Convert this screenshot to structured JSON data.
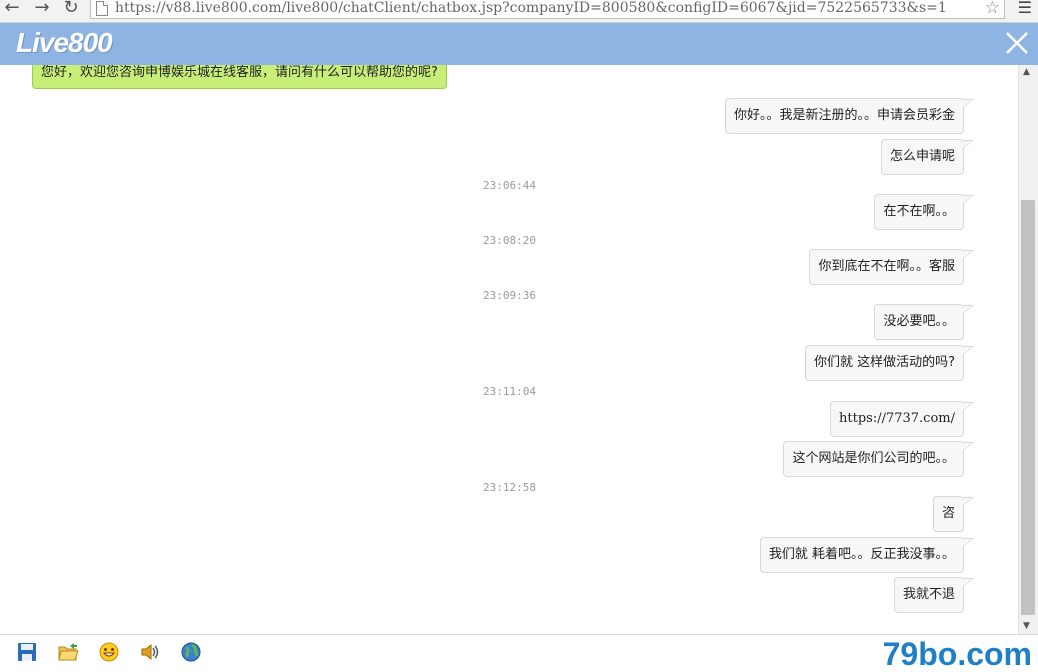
{
  "browser": {
    "url": "https://v88.live800.com/live800/chatClient/chatbox.jsp?companyID=800580&configID=6067&jid=7522565733&s=1"
  },
  "header": {
    "logo": "Live800"
  },
  "messages": [
    {
      "type": "operator",
      "text": "您好，欢迎您咨询申博娱乐城在线客服，请问有什么可以帮助您的呢?"
    },
    {
      "type": "visitor",
      "text": "你好。。我是新注册的。。申请会员彩金"
    },
    {
      "type": "visitor",
      "text": "怎么申请呢"
    },
    {
      "type": "time",
      "text": "23:06:44"
    },
    {
      "type": "visitor",
      "text": "在不在啊。。"
    },
    {
      "type": "time",
      "text": "23:08:20"
    },
    {
      "type": "visitor",
      "text": "你到底在不在啊。。客服"
    },
    {
      "type": "time",
      "text": "23:09:36"
    },
    {
      "type": "visitor",
      "text": "没必要吧。。"
    },
    {
      "type": "visitor",
      "text": "你们就 这样做活动的吗?"
    },
    {
      "type": "time",
      "text": "23:11:04"
    },
    {
      "type": "visitor",
      "text": "https://7737.com/"
    },
    {
      "type": "visitor",
      "text": "这个网站是你们公司的吧。。"
    },
    {
      "type": "time",
      "text": "23:12:58"
    },
    {
      "type": "visitor",
      "text": "咨"
    },
    {
      "type": "visitor",
      "text": "我们就 耗着吧。。反正我没事。。"
    },
    {
      "type": "visitor",
      "text": "我就不退"
    }
  ],
  "toolbar": {
    "watermark": "79bo.com",
    "icons": [
      "save-icon",
      "open-folder-icon",
      "emoticon-icon",
      "sound-icon",
      "globe-icon"
    ]
  },
  "colors": {
    "header": "#8db4e2",
    "operator_bubble": "#c8ee7a",
    "visitor_bubble": "#f7f7f7",
    "watermark": "#1f7fc9"
  }
}
